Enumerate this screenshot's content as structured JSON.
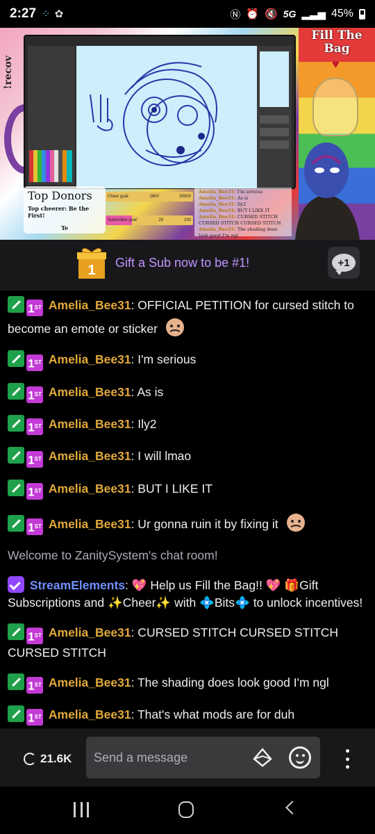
{
  "status_bar": {
    "time": "2:27",
    "network": "5G",
    "battery": "45%"
  },
  "stream": {
    "side_text": "!recov",
    "fill_the_bag": "Fill The Bag",
    "top_donors": {
      "title": "Top Donors",
      "subtitle": "Top cheerer: Be the First!",
      "line2": "Te"
    },
    "goals": [
      {
        "label": "Cheer goal:",
        "current": "2600",
        "target": "30000"
      },
      {
        "label": "Subscriber goal:",
        "current": "29",
        "target": "150"
      }
    ],
    "mini_chat": [
      {
        "name": "Amelia_Bee31:",
        "text": "I'm serious"
      },
      {
        "name": "Amelia_Bee31:",
        "text": "As is"
      },
      {
        "name": "Amelia_Bee31:",
        "text": "Ily2"
      },
      {
        "name": "Amelia_Bee31:",
        "text": "BUT I LIKE IT"
      },
      {
        "name": "Amelia_Bee31:",
        "text": "CURSED STITCH CURSED STITCH CURSED STITCH"
      },
      {
        "name": "Amelia_Bee31:",
        "text": "The shading does look good I'm ngl"
      }
    ]
  },
  "gift_banner": {
    "rank": "1",
    "text": "Gift a Sub now to be #1!",
    "plus_one": "+1"
  },
  "chat": {
    "messages": [
      {
        "user": "Amelia_Bee31",
        "text": ": OFFICIAL PETITION for cursed stitch to become an emote or sticker"
      },
      {
        "user": "Amelia_Bee31",
        "text": ": I'm serious"
      },
      {
        "user": "Amelia_Bee31",
        "text": ": As is"
      },
      {
        "user": "Amelia_Bee31",
        "text": ": Ily2"
      },
      {
        "user": "Amelia_Bee31",
        "text": ": I will lmao"
      },
      {
        "user": "Amelia_Bee31",
        "text": ": BUT I LIKE IT"
      },
      {
        "user": "Amelia_Bee31",
        "text": ": Ur gonna ruin it by fixing it"
      }
    ],
    "welcome": "Welcome to ZanitySystem's chat room!",
    "bot": {
      "user": "StreamElements",
      "p1": ": 💖 Help us Fill the Bag!! 💖 🎁Gift Subscriptions and ✨Cheer✨ with ",
      "p2": "💠Bits💠",
      "p3": " to unlock incentives!"
    },
    "messages2": [
      {
        "user": "Amelia_Bee31",
        "text": ": CURSED STITCH CURSED STITCH CURSED STITCH"
      },
      {
        "user": "Amelia_Bee31",
        "text": ": The shading does look good I'm ngl"
      },
      {
        "user": "Amelia_Bee31",
        "text": ": That's what mods are for duh"
      }
    ],
    "badge_first": "1",
    "badge_first_suffix": "ST"
  },
  "input_bar": {
    "viewer_count": "21.6K",
    "placeholder": "Send a message"
  },
  "colors": {
    "username": "#e2a93b",
    "bot_name": "#6f8fff",
    "gift_text": "#bf94ff",
    "background": "#000000"
  }
}
